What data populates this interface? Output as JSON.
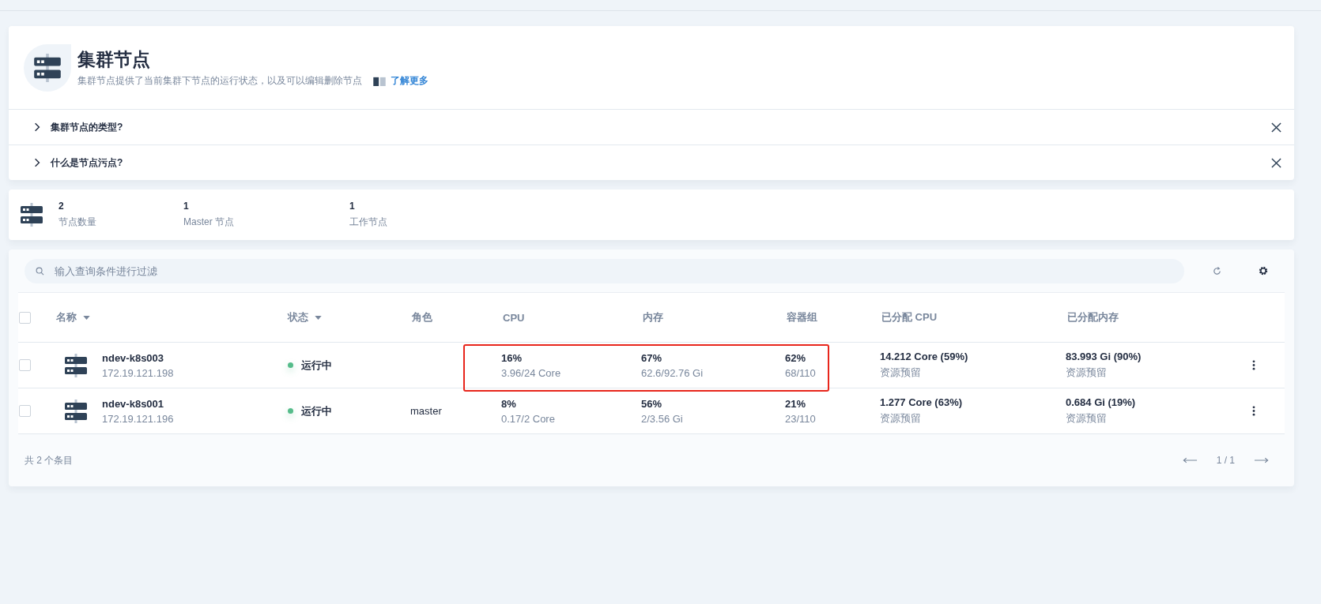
{
  "header": {
    "title": "集群节点",
    "description": "集群节点提供了当前集群下节点的运行状态，以及可以编辑删除节点",
    "link": "了解更多"
  },
  "tips": [
    {
      "question": "集群节点的类型?",
      "expanded": false
    },
    {
      "question": "什么是节点污点?",
      "expanded": false
    }
  ],
  "stats": [
    {
      "value": "2",
      "label": "节点数量"
    },
    {
      "value": "1",
      "label": "Master 节点"
    },
    {
      "value": "1",
      "label": "工作节点"
    }
  ],
  "search": {
    "placeholder": "输入查询条件进行过滤"
  },
  "table": {
    "select_all": {
      "checked": false
    },
    "columns": [
      {
        "label": "名称",
        "sortable": true
      },
      {
        "label": "状态",
        "sortable": true
      },
      {
        "label": "角色",
        "sortable": false
      },
      {
        "label": "CPU",
        "sortable": false
      },
      {
        "label": "内存",
        "sortable": false
      },
      {
        "label": "容器组",
        "sortable": false
      },
      {
        "label": "已分配 CPU",
        "sortable": false
      },
      {
        "label": "已分配内存",
        "sortable": false
      }
    ],
    "rows": [
      {
        "selected": false,
        "highlighted": true,
        "name": "ndev-k8s003",
        "ip": "172.19.121.198",
        "status": {
          "kind": "running",
          "label": "运行中"
        },
        "role": "",
        "cpu": {
          "value": "16%",
          "detail": "3.96/24 Core"
        },
        "memory": {
          "value": "67%",
          "detail": "62.6/92.76 Gi"
        },
        "pods": {
          "value": "62%",
          "detail": "68/110"
        },
        "allocated_cpu": {
          "value": "14.212 Core (59%)",
          "detail": "资源预留"
        },
        "allocated_memory": {
          "value": "83.993 Gi (90%)",
          "detail": "资源预留"
        }
      },
      {
        "selected": false,
        "highlighted": false,
        "name": "ndev-k8s001",
        "ip": "172.19.121.196",
        "status": {
          "kind": "running",
          "label": "运行中"
        },
        "role": "master",
        "cpu": {
          "value": "8%",
          "detail": "0.17/2 Core"
        },
        "memory": {
          "value": "56%",
          "detail": "2/3.56 Gi"
        },
        "pods": {
          "value": "21%",
          "detail": "23/110"
        },
        "allocated_cpu": {
          "value": "1.277 Core (63%)",
          "detail": "资源预留"
        },
        "allocated_memory": {
          "value": "0.684 Gi (19%)",
          "detail": "资源预留"
        }
      }
    ]
  },
  "footer": {
    "total": "共 2 个条目",
    "page": "1 / 1"
  }
}
